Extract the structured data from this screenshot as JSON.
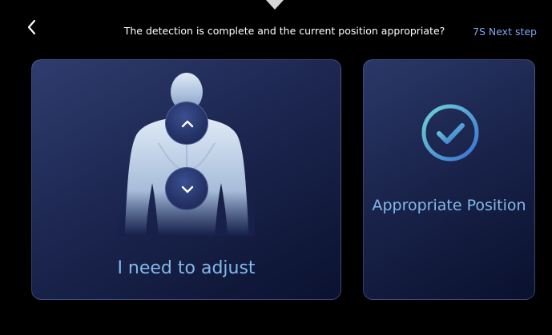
{
  "header": {
    "title": "The detection is complete and the current position appropriate?",
    "next_step": "7S Next step"
  },
  "cards": {
    "adjust": {
      "label": "I need to adjust"
    },
    "appropriate": {
      "label": "Appropriate Position"
    }
  },
  "icons": {
    "back": "chevron-left-icon",
    "up": "chevron-up-icon",
    "down": "chevron-down-icon",
    "check": "check-circle-icon"
  },
  "colors": {
    "background": "#000000",
    "accent_text": "#84b8ea",
    "next_step_text": "#7da7e6",
    "card_top": "#2f3c6e",
    "card_bottom": "#0b1230",
    "check_start": "#6fd3d6",
    "check_end": "#3a6fd0"
  }
}
